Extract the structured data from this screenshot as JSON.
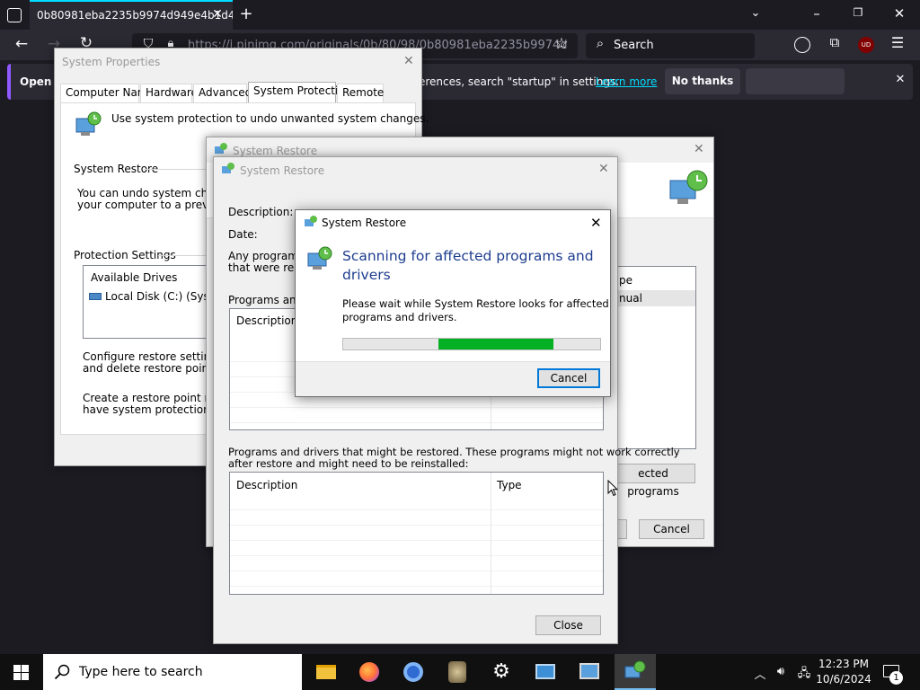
{
  "browser": {
    "tab_title": "0b80981eba2235b9974d949e4b1d40f",
    "url": "https://i.pinimg.com/originals/0b/80/98/0b80981eba2235b9974d",
    "search_placeholder": "Search",
    "extension_badge": "UD",
    "notification": {
      "title_fragment": "Open F",
      "message_fragment": "erences, search \"startup\" in settings.",
      "learn_more": "Learn more",
      "no_thanks": "No thanks"
    }
  },
  "system_properties": {
    "title": "System Properties",
    "tabs": [
      "Computer Name",
      "Hardware",
      "Advanced",
      "System Protection",
      "Remote"
    ],
    "selected_tab": "System Protection",
    "intro": "Use system protection to undo unwanted system changes.",
    "system_restore_heading": "System Restore",
    "system_restore_text_1": "You can undo system changes",
    "system_restore_text_2": "your computer to a previous re",
    "protection_heading": "Protection Settings",
    "drives_header": "Available Drives",
    "drive": "Local Disk (C:) (System)",
    "configure_text_1": "Configure restore settings, ma",
    "configure_text_2": "and delete restore points.",
    "create_text_1": "Create a restore point right no",
    "create_text_2": "have system protection turned"
  },
  "system_restore_back": {
    "title": "System Restore",
    "type_header": "pe",
    "type_value": "nual",
    "scan_button": "ected programs",
    "cancel_button": "Cancel"
  },
  "system_restore_mid": {
    "title": "System Restore",
    "description_label": "Description:",
    "date_label": "Date:",
    "any_programs_1": "Any programs",
    "any_programs_2": "that were remo",
    "programs_deleted_label": "Programs and d",
    "col_description": "Description",
    "restored_label_1": "Programs and drivers that might be restored. These programs might not work correctly",
    "restored_label_2": "after restore and might need to be reinstalled:",
    "col_description_2": "Description",
    "col_type_2": "Type",
    "close_button": "Close"
  },
  "scanning_dialog": {
    "title": "System Restore",
    "heading_1": "Scanning for affected programs and",
    "heading_2": "drivers",
    "body_1": "Please wait while System Restore looks for affected",
    "body_2": "programs and drivers.",
    "progress_label": "Scanning progress",
    "cancel_button": "Cancel"
  },
  "taskbar": {
    "search_placeholder": "Type here to search",
    "time": "12:23 PM",
    "date": "10/6/2024",
    "notification_count": "1"
  },
  "colors": {
    "accent_blue": "#0078d7",
    "progress_green": "#06b025",
    "firefox_accent": "#9059ff",
    "heading_blue": "#1e3d8f"
  }
}
